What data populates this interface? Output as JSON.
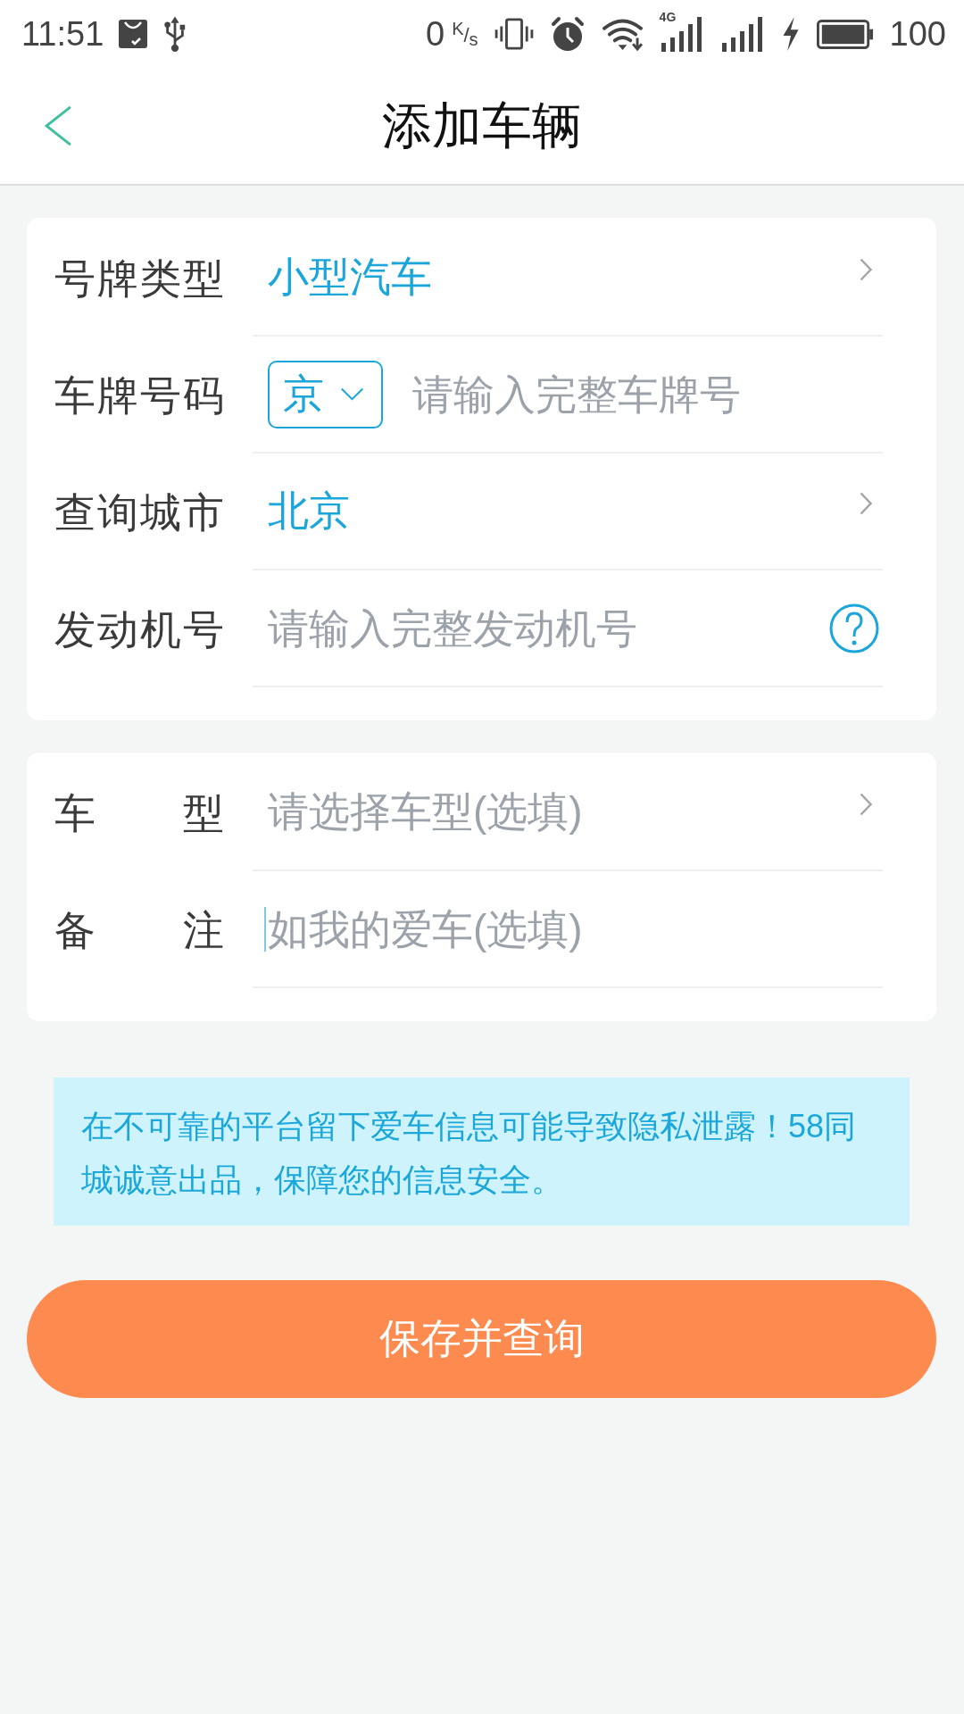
{
  "status_bar": {
    "time": "11:51",
    "net_speed": "0",
    "net_speed_unit": "$^{K}$/$_{s}$",
    "network_type": "4G",
    "charging": true,
    "battery": "100"
  },
  "header": {
    "title": "添加车辆"
  },
  "sections": [
    {
      "rows": [
        {
          "kind": "select",
          "label": "号牌类型",
          "value": "小型汽车"
        },
        {
          "kind": "plate",
          "label": "车牌号码",
          "prefix": "京",
          "placeholder": "请输入完整车牌号"
        },
        {
          "kind": "select",
          "label": "查询城市",
          "value": "北京"
        },
        {
          "kind": "input",
          "label": "发动机号",
          "placeholder": "请输入完整发动机号",
          "focused": false,
          "help": true
        }
      ]
    },
    {
      "rows": [
        {
          "kind": "select",
          "label": "车 型",
          "placeholder": "请选择车型(选填)"
        },
        {
          "kind": "input",
          "label": "备 注",
          "placeholder": "如我的爱车(选填)",
          "focused": true,
          "help": false
        }
      ]
    }
  ],
  "notice": "在不可靠的平台留下爱车信息可能导致隐私泄露！58同城诚意出品，保障您的信息安全。",
  "submit_button": "保存并查询"
}
